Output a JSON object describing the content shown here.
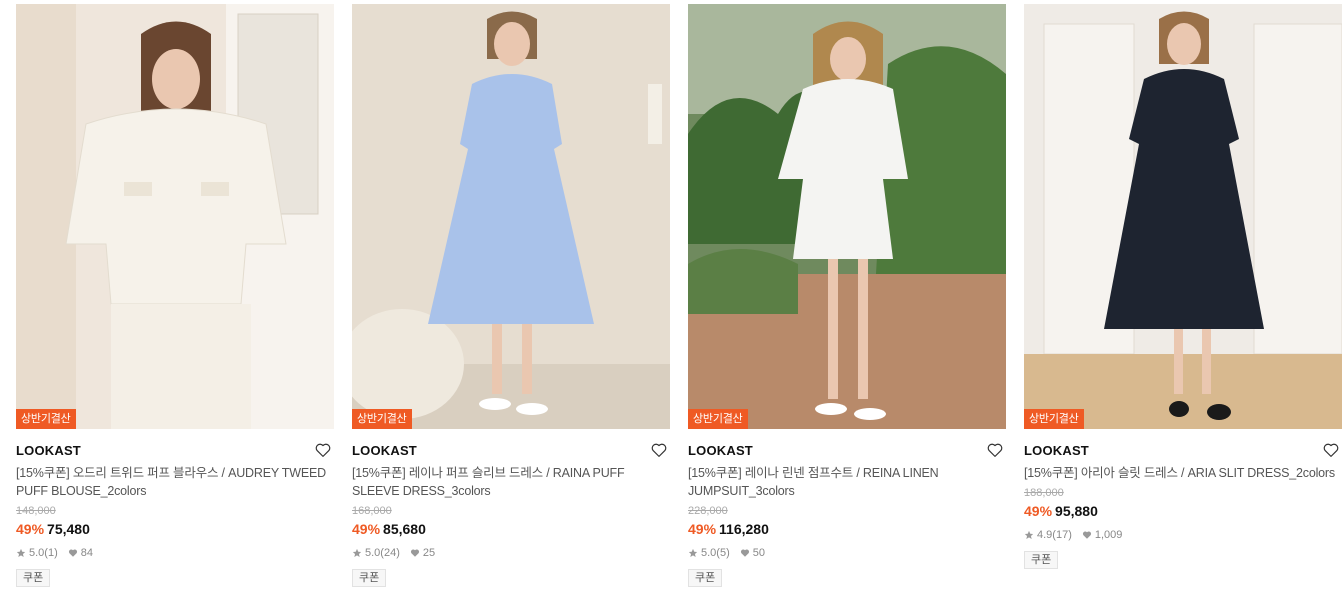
{
  "colors": {
    "accent": "#ef5a24",
    "original_price": "#aaaaaa"
  },
  "products": [
    {
      "badge": "상반기결산",
      "brand": "LOOKAST",
      "name": "[15%쿠폰] 오드리 트위드 퍼프 블라우스 / AUDREY TWEED PUFF BLOUSE_2colors",
      "original_price": "148,000",
      "discount": "49%",
      "price": "75,480",
      "rating": "5.0",
      "reviews": "(1)",
      "likes": "84",
      "tag": "쿠폰",
      "icons": [
        "heart-outline-icon",
        "star-icon",
        "heart-icon"
      ]
    },
    {
      "badge": "상반기결산",
      "brand": "LOOKAST",
      "name": "[15%쿠폰] 레이나 퍼프 슬리브 드레스 / RAINA PUFF SLEEVE DRESS_3colors",
      "original_price": "168,000",
      "discount": "49%",
      "price": "85,680",
      "rating": "5.0",
      "reviews": "(24)",
      "likes": "25",
      "tag": "쿠폰"
    },
    {
      "badge": "상반기결산",
      "brand": "LOOKAST",
      "name": "[15%쿠폰] 레이나 린넨 점프수트 / REINA LINEN JUMPSUIT_3colors",
      "original_price": "228,000",
      "discount": "49%",
      "price": "116,280",
      "rating": "5.0",
      "reviews": "(5)",
      "likes": "50",
      "tag": "쿠폰"
    },
    {
      "badge": "상반기결산",
      "brand": "LOOKAST",
      "name": "[15%쿠폰] 아리아 슬릿 드레스 / ARIA SLIT DRESS_2colors",
      "original_price": "188,000",
      "discount": "49%",
      "price": "95,880",
      "rating": "4.9",
      "reviews": "(17)",
      "likes": "1,009",
      "tag": "쿠폰"
    }
  ]
}
